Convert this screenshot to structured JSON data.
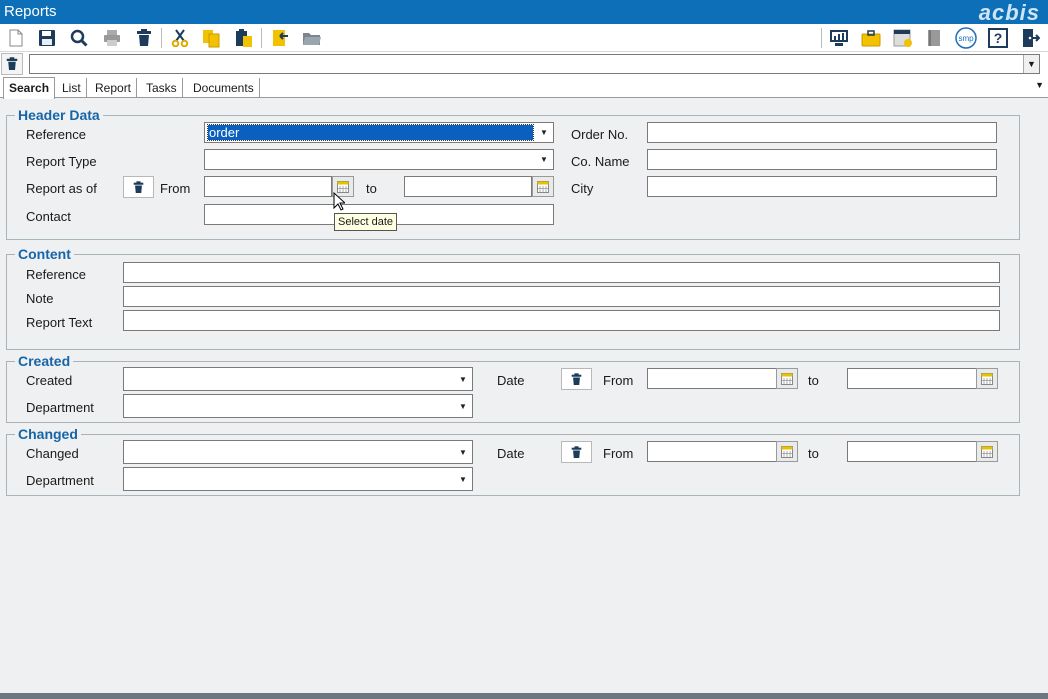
{
  "window": {
    "title": "Reports",
    "brand": "acbis"
  },
  "toolbar": {
    "left_icons": [
      "new-document-icon",
      "save-icon",
      "search-icon",
      "print-icon",
      "delete-icon",
      "cut-icon",
      "copy-icon",
      "paste-icon",
      "import-icon",
      "open-folder-icon"
    ],
    "right_icons": [
      "monitor-chart-icon",
      "briefcase-icon",
      "calendar-check-icon",
      "book-icon",
      "smp-icon",
      "help-icon",
      "exit-icon"
    ],
    "smp_label": "smp"
  },
  "tabs": [
    {
      "label": "Search",
      "active": true
    },
    {
      "label": "List"
    },
    {
      "label": "Report"
    },
    {
      "label": "Tasks"
    },
    {
      "label": "Documents"
    }
  ],
  "header_data": {
    "legend": "Header Data",
    "reference_label": "Reference",
    "reference_value": "order",
    "report_type_label": "Report Type",
    "report_type_value": "",
    "report_as_of_label": "Report as of",
    "from_label": "From",
    "to_label": "to",
    "contact_label": "Contact",
    "order_no_label": "Order No.",
    "co_name_label": "Co. Name",
    "city_label": "City",
    "tooltip": "Select date"
  },
  "content": {
    "legend": "Content",
    "reference_label": "Reference",
    "note_label": "Note",
    "report_text_label": "Report Text"
  },
  "created": {
    "legend": "Created",
    "created_label": "Created",
    "department_label": "Department",
    "date_label": "Date",
    "from_label": "From",
    "to_label": "to"
  },
  "changed": {
    "legend": "Changed",
    "changed_label": "Changed",
    "department_label": "Department",
    "date_label": "Date",
    "from_label": "From",
    "to_label": "to"
  },
  "colors": {
    "titlebar": "#0d6fb8",
    "legend": "#1765a8",
    "selection": "#0a5fbf"
  }
}
